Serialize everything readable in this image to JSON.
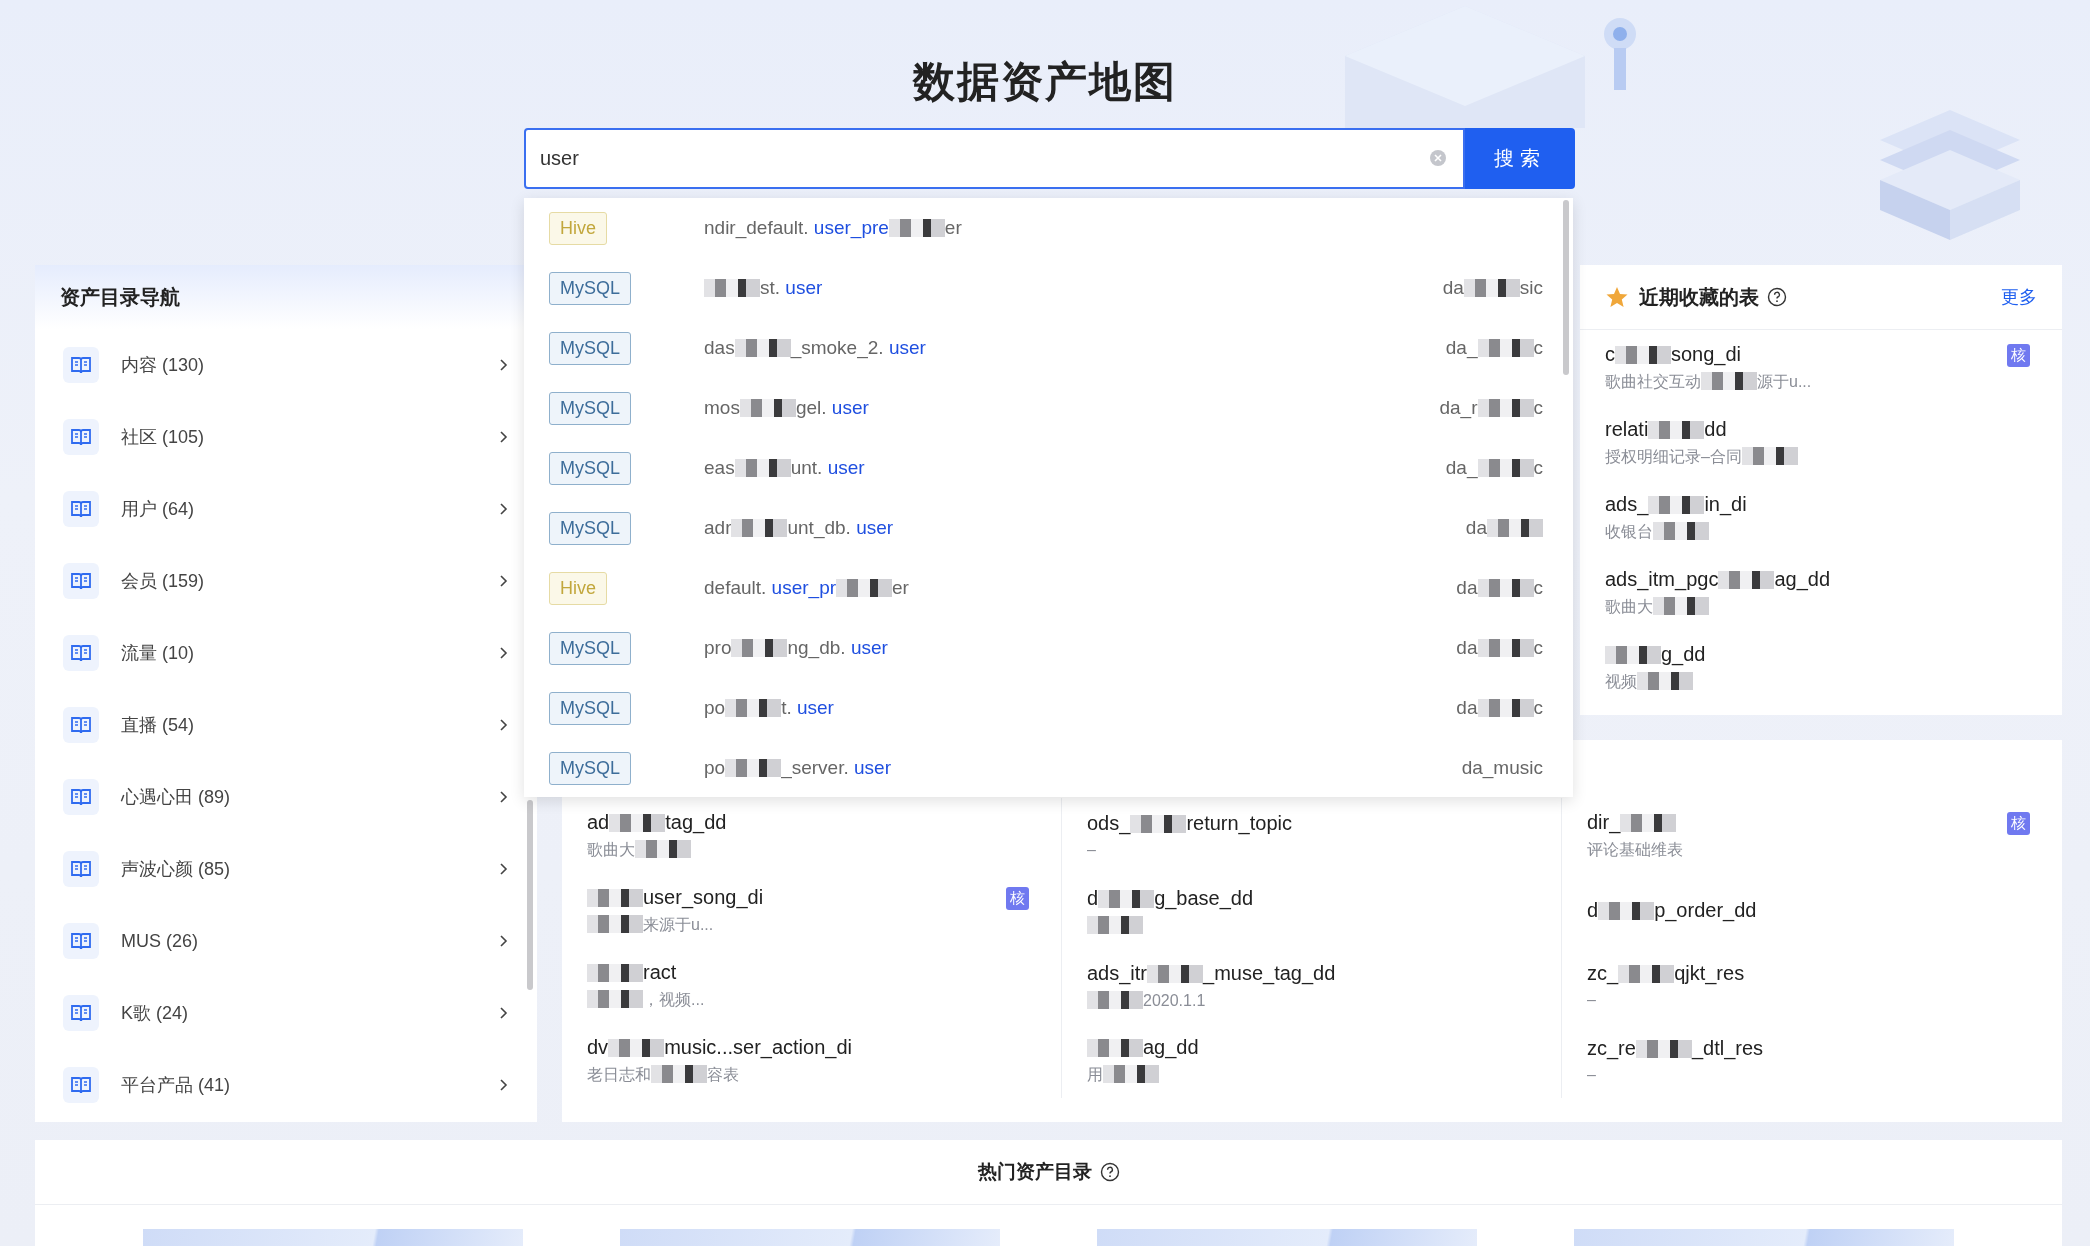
{
  "page": {
    "title": "数据资产地图"
  },
  "search": {
    "value": "user",
    "button": "搜索",
    "suggestions": [
      {
        "source": "Hive",
        "kind": "hive",
        "name": [
          {
            "kind": "text",
            "text": "ndir_default. "
          },
          {
            "kind": "match",
            "text": "user_pre"
          },
          {
            "kind": "mosaic"
          },
          {
            "kind": "text",
            "text": "er"
          }
        ]
      },
      {
        "source": "MySQL",
        "kind": "mysql",
        "name": [
          {
            "kind": "mosaic"
          },
          {
            "kind": "text",
            "text": "st. "
          },
          {
            "kind": "match",
            "text": "user"
          }
        ],
        "owner": [
          {
            "kind": "text",
            "text": "da"
          },
          {
            "kind": "mosaic"
          },
          {
            "kind": "text",
            "text": "sic"
          }
        ]
      },
      {
        "source": "MySQL",
        "kind": "mysql",
        "name": [
          {
            "kind": "text",
            "text": "das"
          },
          {
            "kind": "mosaic"
          },
          {
            "kind": "text",
            "text": "_smoke_2. "
          },
          {
            "kind": "match",
            "text": "user"
          }
        ],
        "owner": [
          {
            "kind": "text",
            "text": "da_"
          },
          {
            "kind": "mosaic"
          },
          {
            "kind": "text",
            "text": "c"
          }
        ]
      },
      {
        "source": "MySQL",
        "kind": "mysql",
        "name": [
          {
            "kind": "text",
            "text": "mos"
          },
          {
            "kind": "mosaic"
          },
          {
            "kind": "text",
            "text": "gel. "
          },
          {
            "kind": "match",
            "text": "user"
          }
        ],
        "owner": [
          {
            "kind": "text",
            "text": "da_r"
          },
          {
            "kind": "mosaic"
          },
          {
            "kind": "text",
            "text": "c"
          }
        ]
      },
      {
        "source": "MySQL",
        "kind": "mysql",
        "name": [
          {
            "kind": "text",
            "text": "eas"
          },
          {
            "kind": "mosaic"
          },
          {
            "kind": "text",
            "text": "unt. "
          },
          {
            "kind": "match",
            "text": "user"
          }
        ],
        "owner": [
          {
            "kind": "text",
            "text": "da_"
          },
          {
            "kind": "mosaic"
          },
          {
            "kind": "text",
            "text": "c"
          }
        ]
      },
      {
        "source": "MySQL",
        "kind": "mysql",
        "name": [
          {
            "kind": "text",
            "text": "adr"
          },
          {
            "kind": "mosaic"
          },
          {
            "kind": "text",
            "text": "unt_db. "
          },
          {
            "kind": "match",
            "text": "user"
          }
        ],
        "owner": [
          {
            "kind": "text",
            "text": "da"
          },
          {
            "kind": "mosaic"
          }
        ]
      },
      {
        "source": "Hive",
        "kind": "hive",
        "name": [
          {
            "kind": "text",
            "text": "default. "
          },
          {
            "kind": "match",
            "text": "user_pr"
          },
          {
            "kind": "mosaic"
          },
          {
            "kind": "text",
            "text": "er"
          }
        ],
        "owner": [
          {
            "kind": "text",
            "text": "da"
          },
          {
            "kind": "mosaic"
          },
          {
            "kind": "text",
            "text": "c"
          }
        ]
      },
      {
        "source": "MySQL",
        "kind": "mysql",
        "name": [
          {
            "kind": "text",
            "text": "pro"
          },
          {
            "kind": "mosaic"
          },
          {
            "kind": "text",
            "text": "ng_db. "
          },
          {
            "kind": "match",
            "text": "user"
          }
        ],
        "owner": [
          {
            "kind": "text",
            "text": "da"
          },
          {
            "kind": "mosaic"
          },
          {
            "kind": "text",
            "text": "c"
          }
        ]
      },
      {
        "source": "MySQL",
        "kind": "mysql",
        "name": [
          {
            "kind": "text",
            "text": "po"
          },
          {
            "kind": "mosaic"
          },
          {
            "kind": "text",
            "text": "t. "
          },
          {
            "kind": "match",
            "text": "user"
          }
        ],
        "owner": [
          {
            "kind": "text",
            "text": "da"
          },
          {
            "kind": "mosaic"
          },
          {
            "kind": "text",
            "text": "c"
          }
        ]
      },
      {
        "source": "MySQL",
        "kind": "mysql",
        "name": [
          {
            "kind": "text",
            "text": "po"
          },
          {
            "kind": "mosaic"
          },
          {
            "kind": "text",
            "text": "_server. "
          },
          {
            "kind": "match",
            "text": "user"
          }
        ],
        "owner": [
          {
            "kind": "text",
            "text": "da_music"
          }
        ]
      }
    ]
  },
  "sidebar": {
    "title": "资产目录导航",
    "items": [
      {
        "label": "内容 (130)"
      },
      {
        "label": "社区 (105)"
      },
      {
        "label": "用户 (64)"
      },
      {
        "label": "会员 (159)"
      },
      {
        "label": "流量 (10)"
      },
      {
        "label": "直播 (54)"
      },
      {
        "label": "心遇心田 (89)"
      },
      {
        "label": "声波心颜 (85)"
      },
      {
        "label": "MUS (26)"
      },
      {
        "label": "K歌 (24)"
      },
      {
        "label": "平台产品 (41)"
      }
    ]
  },
  "favorites": {
    "title": "近期收藏的表",
    "more": "更多",
    "items": [
      {
        "name": [
          {
            "kind": "text",
            "text": "c"
          },
          {
            "kind": "mosaic"
          },
          {
            "kind": "text",
            "text": "song_di"
          }
        ],
        "desc": [
          {
            "kind": "text",
            "text": "歌曲社交互动"
          },
          {
            "kind": "mosaic"
          },
          {
            "kind": "text",
            "text": "源于u..."
          }
        ],
        "badge": "核"
      },
      {
        "name": [
          {
            "kind": "text",
            "text": "relati"
          },
          {
            "kind": "mosaic"
          },
          {
            "kind": "text",
            "text": "dd"
          }
        ],
        "desc": [
          {
            "kind": "text",
            "text": "授权明细记录–合同"
          },
          {
            "kind": "mosaic"
          }
        ]
      },
      {
        "name": [
          {
            "kind": "text",
            "text": "ads_"
          },
          {
            "kind": "mosaic"
          },
          {
            "kind": "text",
            "text": "in_di"
          }
        ],
        "desc": [
          {
            "kind": "text",
            "text": "收银台"
          },
          {
            "kind": "mosaic"
          }
        ]
      },
      {
        "name": [
          {
            "kind": "text",
            "text": "ads_itm_pgc"
          },
          {
            "kind": "mosaic"
          },
          {
            "kind": "text",
            "text": "ag_dd"
          }
        ],
        "desc": [
          {
            "kind": "text",
            "text": "歌曲大"
          },
          {
            "kind": "mosaic"
          }
        ]
      },
      {
        "name": [
          {
            "kind": "mosaic"
          },
          {
            "kind": "text",
            "text": "g_dd"
          }
        ],
        "desc": [
          {
            "kind": "text",
            "text": "视频"
          },
          {
            "kind": "mosaic"
          }
        ]
      }
    ]
  },
  "tables": {
    "items": [
      {
        "name": [
          {
            "kind": "text",
            "text": "ad"
          },
          {
            "kind": "mosaic"
          },
          {
            "kind": "text",
            "text": "tag_dd"
          }
        ],
        "desc": [
          {
            "kind": "text",
            "text": "歌曲大"
          },
          {
            "kind": "mosaic"
          }
        ]
      },
      {
        "name": [
          {
            "kind": "text",
            "text": "ods_"
          },
          {
            "kind": "mosaic"
          },
          {
            "kind": "text",
            "text": "return_topic"
          }
        ],
        "desc": [
          {
            "kind": "text",
            "text": "–"
          }
        ]
      },
      {
        "name": [
          {
            "kind": "text",
            "text": "dir_"
          },
          {
            "kind": "mosaic"
          }
        ],
        "desc": [
          {
            "kind": "text",
            "text": "评论基础维表"
          }
        ],
        "badge": "核"
      },
      {
        "name": [
          {
            "kind": "mosaic"
          },
          {
            "kind": "text",
            "text": "user_song_di"
          }
        ],
        "desc": [
          {
            "kind": "mosaic"
          },
          {
            "kind": "text",
            "text": "来源于u..."
          }
        ],
        "badge": "核"
      },
      {
        "name": [
          {
            "kind": "text",
            "text": "d"
          },
          {
            "kind": "mosaic"
          },
          {
            "kind": "text",
            "text": "g_base_dd"
          }
        ],
        "desc": [
          {
            "kind": "mosaic"
          }
        ]
      },
      {
        "name": [
          {
            "kind": "text",
            "text": "d"
          },
          {
            "kind": "mosaic"
          },
          {
            "kind": "text",
            "text": "p_order_dd"
          }
        ]
      },
      {
        "name": [
          {
            "kind": "mosaic"
          },
          {
            "kind": "text",
            "text": "ract"
          }
        ],
        "desc": [
          {
            "kind": "mosaic"
          },
          {
            "kind": "text",
            "text": "，视频..."
          }
        ]
      },
      {
        "name": [
          {
            "kind": "text",
            "text": "ads_itr"
          },
          {
            "kind": "mosaic"
          },
          {
            "kind": "text",
            "text": "_muse_tag_dd"
          }
        ],
        "desc": [
          {
            "kind": "mosaic"
          },
          {
            "kind": "text",
            "text": "2020.1.1"
          }
        ]
      },
      {
        "name": [
          {
            "kind": "text",
            "text": "zc_"
          },
          {
            "kind": "mosaic"
          },
          {
            "kind": "text",
            "text": "qjkt_res"
          }
        ],
        "desc": [
          {
            "kind": "text",
            "text": "–"
          }
        ]
      },
      {
        "name": [
          {
            "kind": "text",
            "text": "dv"
          },
          {
            "kind": "mosaic"
          },
          {
            "kind": "text",
            "text": "music...ser_action_di"
          }
        ],
        "desc": [
          {
            "kind": "text",
            "text": "老日志和"
          },
          {
            "kind": "mosaic"
          },
          {
            "kind": "text",
            "text": "容表"
          }
        ]
      },
      {
        "name": [
          {
            "kind": "mosaic"
          },
          {
            "kind": "text",
            "text": "ag_dd"
          }
        ],
        "desc": [
          {
            "kind": "text",
            "text": "用"
          },
          {
            "kind": "mosaic"
          }
        ]
      },
      {
        "name": [
          {
            "kind": "text",
            "text": "zc_re"
          },
          {
            "kind": "mosaic"
          },
          {
            "kind": "text",
            "text": "_dtl_res"
          }
        ],
        "desc": [
          {
            "kind": "text",
            "text": "–"
          }
        ]
      }
    ]
  },
  "hot": {
    "title": "热门资产目录",
    "cards": [
      {
        "kind": "card"
      },
      {
        "kind": "card"
      },
      {
        "kind": "card"
      },
      {
        "kind": "card"
      }
    ]
  }
}
